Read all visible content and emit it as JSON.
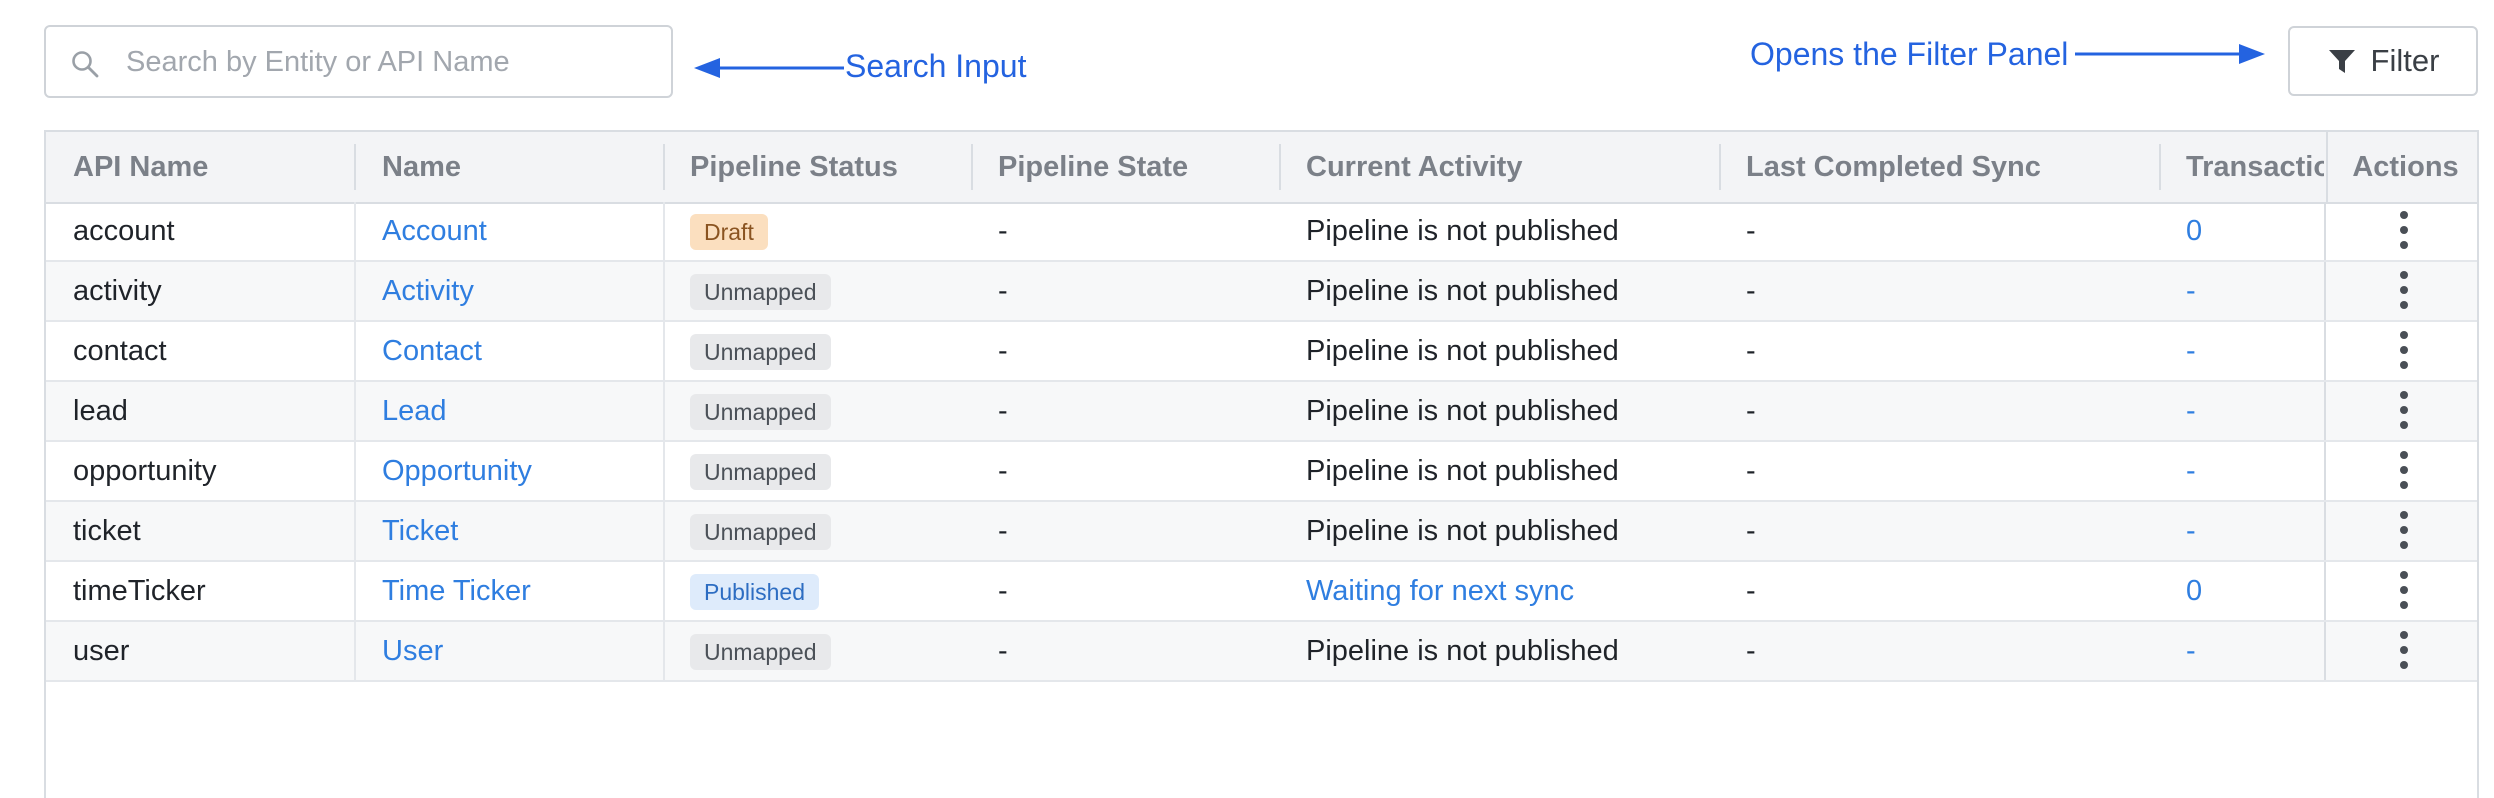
{
  "search": {
    "placeholder": "Search by Entity or API Name",
    "value": ""
  },
  "annotations": {
    "search": "Search Input",
    "filter": "Opens the Filter Panel"
  },
  "toolbar": {
    "filter_label": "Filter"
  },
  "table": {
    "columns": [
      "API Name",
      "Name",
      "Pipeline Status",
      "Pipeline State",
      "Current Activity",
      "Last Completed Sync",
      "Transactions",
      "Actions"
    ],
    "rows": [
      {
        "api_name": "account",
        "name": "Account",
        "status": "Draft",
        "status_kind": "draft",
        "state": "-",
        "activity": "Pipeline is not published",
        "activity_link": false,
        "last_sync": "-",
        "transactions": "0"
      },
      {
        "api_name": "activity",
        "name": "Activity",
        "status": "Unmapped",
        "status_kind": "unmapped",
        "state": "-",
        "activity": "Pipeline is not published",
        "activity_link": false,
        "last_sync": "-",
        "transactions": "-"
      },
      {
        "api_name": "contact",
        "name": "Contact",
        "status": "Unmapped",
        "status_kind": "unmapped",
        "state": "-",
        "activity": "Pipeline is not published",
        "activity_link": false,
        "last_sync": "-",
        "transactions": "-"
      },
      {
        "api_name": "lead",
        "name": "Lead",
        "status": "Unmapped",
        "status_kind": "unmapped",
        "state": "-",
        "activity": "Pipeline is not published",
        "activity_link": false,
        "last_sync": "-",
        "transactions": "-"
      },
      {
        "api_name": "opportunity",
        "name": "Opportunity",
        "status": "Unmapped",
        "status_kind": "unmapped",
        "state": "-",
        "activity": "Pipeline is not published",
        "activity_link": false,
        "last_sync": "-",
        "transactions": "-"
      },
      {
        "api_name": "ticket",
        "name": "Ticket",
        "status": "Unmapped",
        "status_kind": "unmapped",
        "state": "-",
        "activity": "Pipeline is not published",
        "activity_link": false,
        "last_sync": "-",
        "transactions": "-"
      },
      {
        "api_name": "timeTicker",
        "name": "Time Ticker",
        "status": "Published",
        "status_kind": "published",
        "state": "-",
        "activity": "Waiting for next sync",
        "activity_link": true,
        "last_sync": "-",
        "transactions": "0"
      },
      {
        "api_name": "user",
        "name": "User",
        "status": "Unmapped",
        "status_kind": "unmapped",
        "state": "-",
        "activity": "Pipeline is not published",
        "activity_link": false,
        "last_sync": "-",
        "transactions": "-"
      }
    ]
  },
  "colors": {
    "accent": "#2f7ee0",
    "annotation": "#2463e0",
    "draft_badge": "#fbdfbf",
    "unmapped_badge": "#e8e9eb",
    "published_badge": "#deebfb"
  },
  "icons": {
    "search": "search-icon",
    "filter": "filter-funnel-icon",
    "row_actions": "kebab-menu-icon"
  }
}
